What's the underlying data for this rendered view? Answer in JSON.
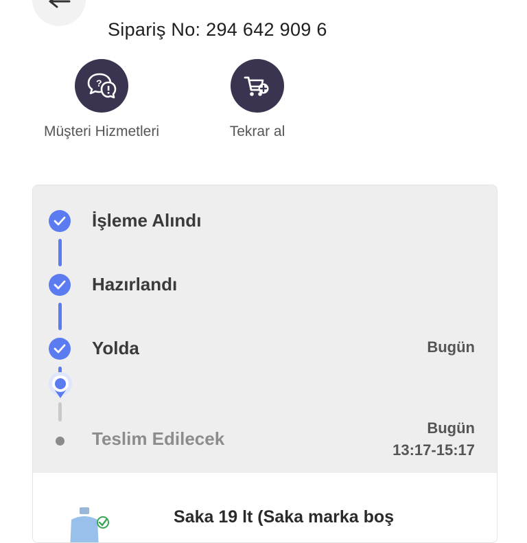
{
  "header": {
    "order_number": "Sipariş No: 294 642 909 6"
  },
  "actions": [
    {
      "label": "Müşteri Hizmetleri",
      "icon": "customer-service-chat-icon"
    },
    {
      "label": "Tekrar al",
      "icon": "cart-add-icon"
    }
  ],
  "tracking": {
    "steps": [
      {
        "label": "İşleme Alındı",
        "status": "done",
        "date": ""
      },
      {
        "label": "Hazırlandı",
        "status": "done",
        "date": ""
      },
      {
        "label": "Yolda",
        "status": "done",
        "date": "Bugün"
      },
      {
        "label": "Teslim Edilecek",
        "status": "pending",
        "date": "Bugün",
        "time": "13:17-15:17"
      }
    ]
  },
  "product": {
    "title": "Saka 19 lt (Saka marka boş"
  },
  "colors": {
    "accent": "#5b7cf0",
    "action_circle": "#3a3450",
    "tracker_bg": "#eeeeee"
  }
}
